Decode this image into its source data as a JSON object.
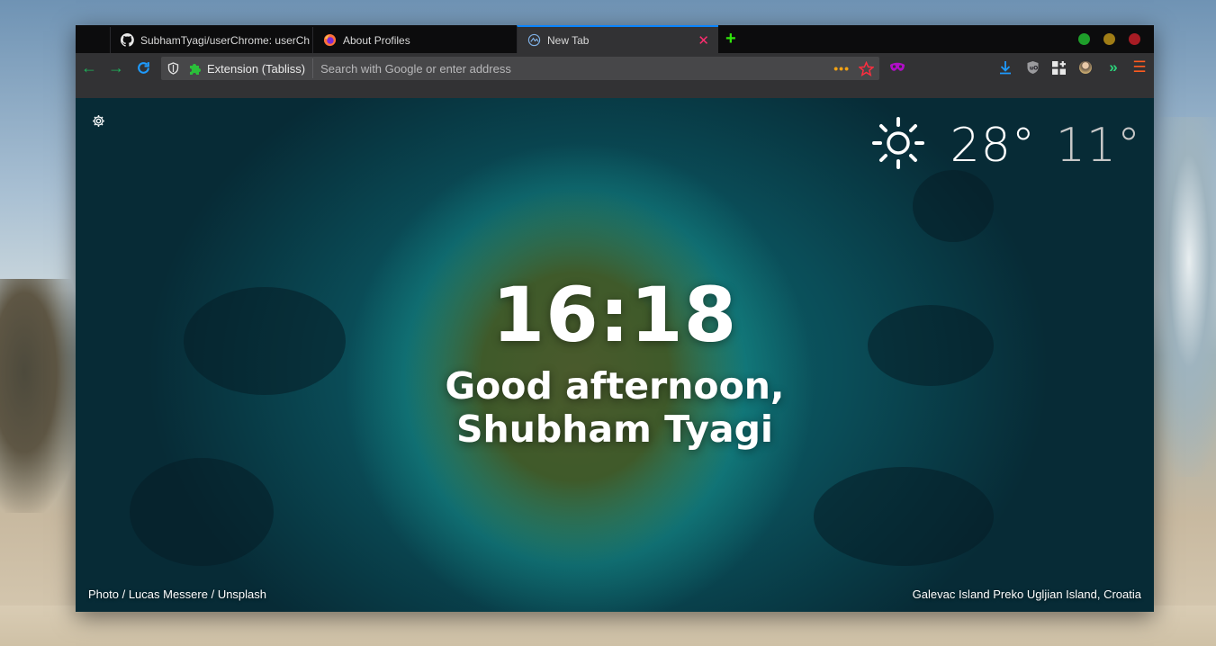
{
  "tabs": [
    {
      "title": "SubhamTyagi/userChrome: userCh",
      "icon": "github-icon"
    },
    {
      "title": "About Profiles",
      "icon": "firefox-icon"
    },
    {
      "title": "New Tab",
      "icon": "tabliss-icon",
      "active": true
    }
  ],
  "urlbar": {
    "extension_label": "Extension (Tabliss)",
    "placeholder": "Search with Google or enter address"
  },
  "page": {
    "time": "16:18",
    "greeting_line1": "Good afternoon,",
    "greeting_line2": "Shubham Tyagi",
    "weather": {
      "icon": "sun-icon",
      "high": "28°",
      "low": "11°"
    },
    "credit": {
      "prefix": "Photo / ",
      "author": "Lucas Messere",
      "separator": " / ",
      "source": "Unsplash"
    },
    "location": "Galevac Island Preko Ugljian Island, Croatia"
  },
  "colors": {
    "accent": "#0a84ff",
    "new_tab_plus": "#30e60b",
    "tab_close": "#ff2d6f",
    "window_green": "#1e9e2a",
    "window_yellow": "#a07d16",
    "window_red": "#a81c24"
  }
}
